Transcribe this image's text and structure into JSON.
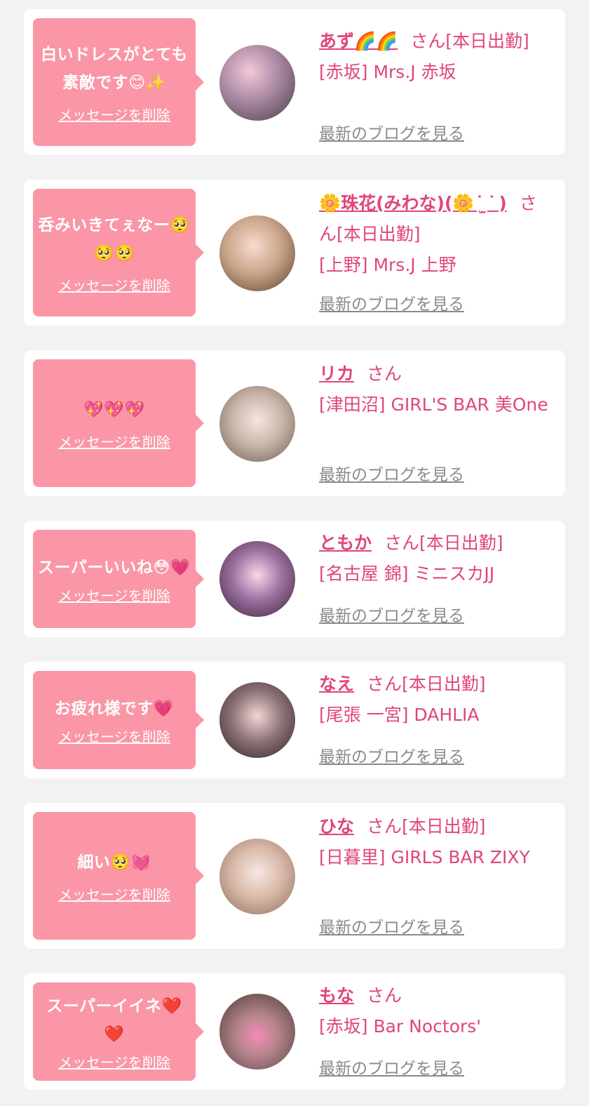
{
  "delete_label": "メッセージを削除",
  "blog_label": "最新のブログを見る",
  "san_label": "さん",
  "colors": {
    "bubble": "#fa96a6",
    "name": "#e0457a",
    "link_gray": "#8a8a8a",
    "background": "#f2f2f2"
  },
  "cards": [
    {
      "message": "白いドレスがとても素敵です😊✨",
      "name": "あず🌈🌈",
      "status": "[本日出勤]",
      "shop": "[赤坂] Mrs.J 赤坂",
      "avatar_icon": "avatar-photo-icon"
    },
    {
      "message": "呑みいきてぇなー🥺🥺🥺",
      "name": "🌼珠花(みわな)(🌼 ͘ ̫ ͘ )",
      "status": "[本日出勤]",
      "shop": "[上野] Mrs.J 上野",
      "avatar_icon": "avatar-photo-icon"
    },
    {
      "message": "💖💖💖",
      "name": "リカ",
      "status": "",
      "shop": "[津田沼] GIRL'S BAR 美One",
      "avatar_icon": "avatar-photo-icon"
    },
    {
      "message": "スーパーいいね😳💗",
      "name": "ともか",
      "status": "[本日出勤]",
      "shop": "[名古屋 錦] ミニスカJJ",
      "avatar_icon": "avatar-photo-icon"
    },
    {
      "message": "お疲れ様です💗",
      "name": "なえ",
      "status": "[本日出勤]",
      "shop": "[尾張 一宮] DAHLIA",
      "avatar_icon": "avatar-photo-icon"
    },
    {
      "message": "細い🥺💓",
      "name": "ひな",
      "status": "[本日出勤]",
      "shop": "[日暮里] GIRLS BAR ZIXY",
      "avatar_icon": "avatar-photo-icon"
    },
    {
      "message": "スーパーイイネ❤️❤️",
      "name": "もな",
      "status": "",
      "shop": "[赤坂] Bar Noctors'",
      "avatar_icon": "avatar-photo-icon"
    }
  ]
}
